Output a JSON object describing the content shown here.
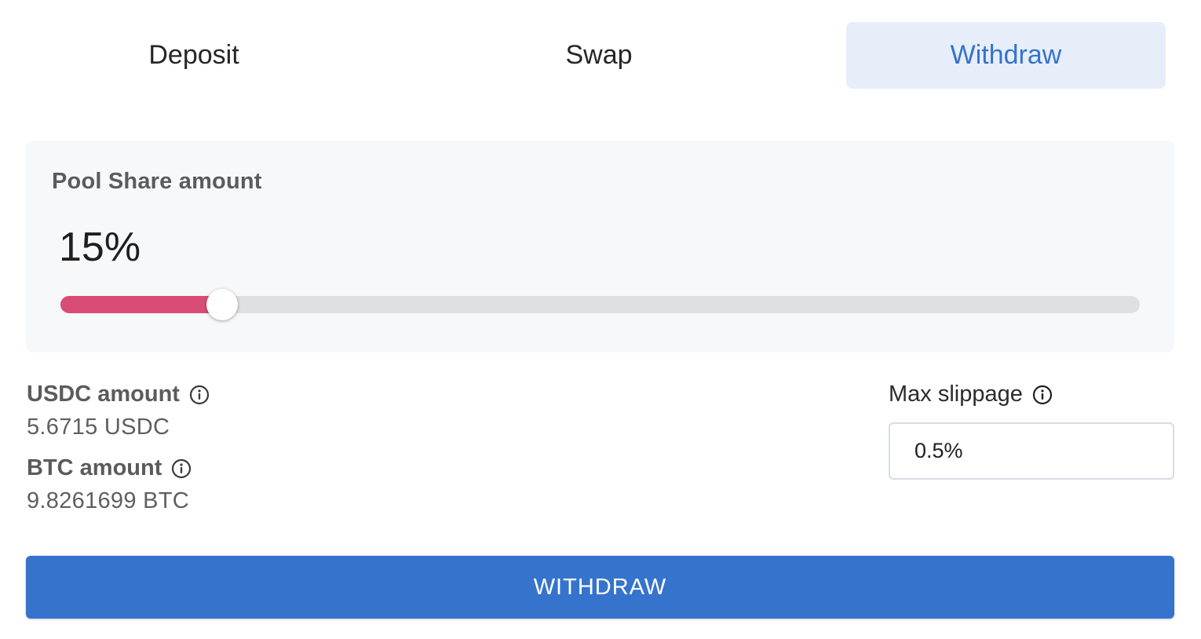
{
  "tabs": [
    {
      "label": "Deposit",
      "active": false
    },
    {
      "label": "Swap",
      "active": false
    },
    {
      "label": "Withdraw",
      "active": true
    }
  ],
  "pool_share": {
    "label": "Pool Share amount",
    "value_text": "15%",
    "value_percent": 15,
    "fill_color": "#d94c76",
    "track_color": "#dfe0e3"
  },
  "amounts": {
    "usdc": {
      "label": "USDC amount",
      "value": "5.6715 USDC",
      "icon": "info-icon"
    },
    "btc": {
      "label": "BTC amount",
      "value": "9.8261699 BTC",
      "icon": "info-icon"
    }
  },
  "slippage": {
    "label": "Max slippage",
    "icon": "info-icon",
    "value": "0.5%"
  },
  "actions": {
    "withdraw_label": "WITHDRAW"
  },
  "colors": {
    "accent": "#3673cc",
    "active_tab_bg": "#e7eefa",
    "panel_bg": "#f7f8fa"
  }
}
